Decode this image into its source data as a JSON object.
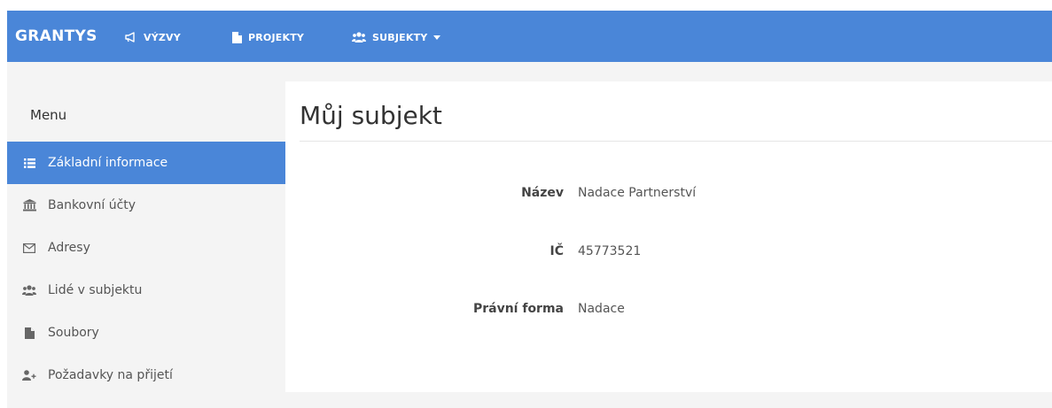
{
  "navbar": {
    "brand": "GRANTYS",
    "items": [
      {
        "label": "VÝZVY",
        "icon": "bullhorn-icon"
      },
      {
        "label": "PROJEKTY",
        "icon": "file-icon"
      },
      {
        "label": "SUBJEKTY",
        "icon": "users-icon",
        "caret": "caret-down-icon"
      }
    ]
  },
  "sidebar": {
    "title": "Menu",
    "items": [
      {
        "label": "Základní informace",
        "icon": "list-icon",
        "active": true
      },
      {
        "label": "Bankovní účty",
        "icon": "bank-icon",
        "active": false
      },
      {
        "label": "Adresy",
        "icon": "envelope-icon",
        "active": false
      },
      {
        "label": "Lidé v subjektu",
        "icon": "users-icon",
        "active": false
      },
      {
        "label": "Soubory",
        "icon": "file-icon",
        "active": false
      },
      {
        "label": "Požadavky na přijetí",
        "icon": "user-plus-icon",
        "active": false
      }
    ]
  },
  "main": {
    "title": "Můj subjekt",
    "fields": [
      {
        "label": "Název",
        "value": "Nadace Partnerství"
      },
      {
        "label": "IČ",
        "value": "45773521"
      },
      {
        "label": "Právní forma",
        "value": "Nadace"
      }
    ]
  },
  "colors": {
    "accent": "#4a86d8",
    "background": "#f4f4f4",
    "panel": "#ffffff"
  }
}
